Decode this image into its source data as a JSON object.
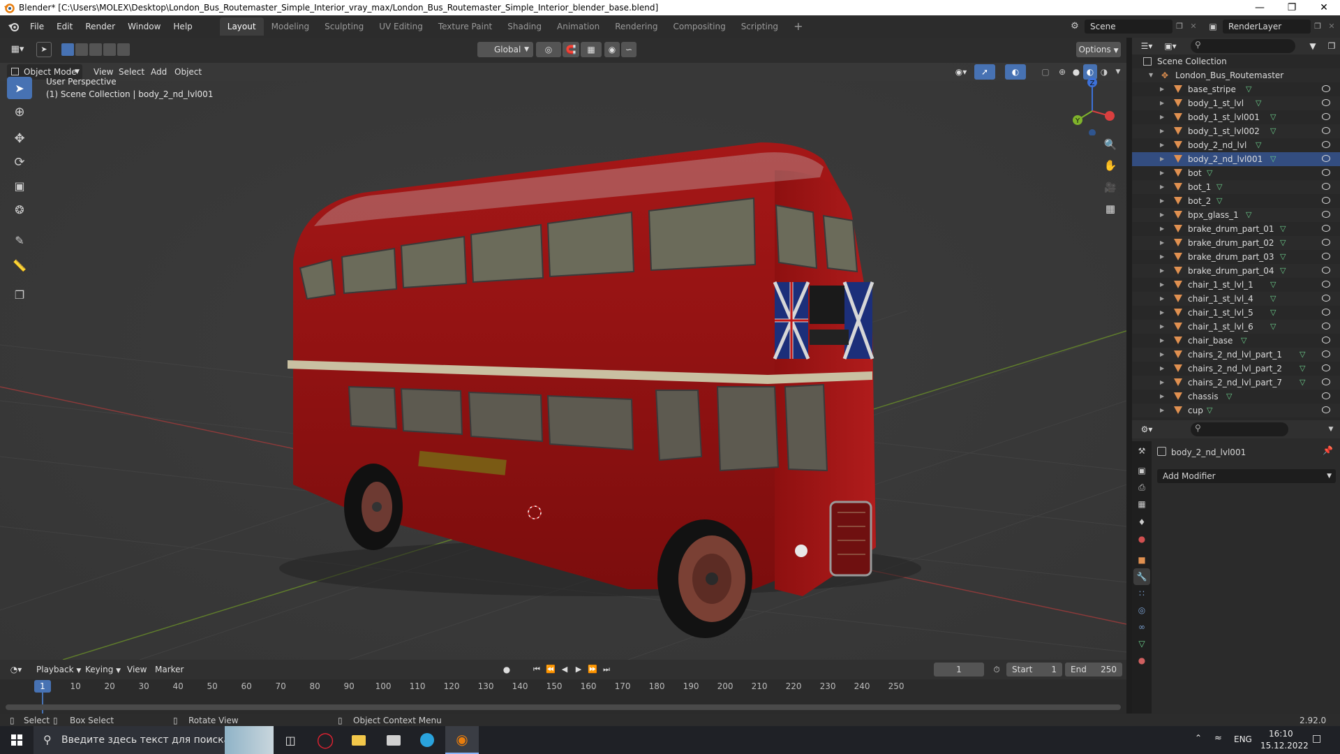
{
  "window": {
    "title": "Blender* [C:\\Users\\MOLEX\\Desktop\\London_Bus_Routemaster_Simple_Interior_vray_max/London_Bus_Routemaster_Simple_Interior_blender_base.blend]",
    "minimize_icon": "minimize-icon",
    "maximize_icon": "restore-icon",
    "close_icon": "close-icon"
  },
  "topbar": {
    "menus": [
      "File",
      "Edit",
      "Render",
      "Window",
      "Help"
    ],
    "workspaces": [
      "Layout",
      "Modeling",
      "Sculpting",
      "UV Editing",
      "Texture Paint",
      "Shading",
      "Animation",
      "Rendering",
      "Compositing",
      "Scripting"
    ],
    "active_workspace": "Layout",
    "add_workspace": "+",
    "scene_name": "Scene",
    "view_layer": "RenderLayer"
  },
  "viewport": {
    "mode": "Object Mode",
    "menus": [
      "View",
      "Select",
      "Add",
      "Object"
    ],
    "orientation": "Global",
    "options_label": "Options",
    "overlay_title": "User Perspective",
    "overlay_collection": "(1) Scene Collection | body_2_nd_lvl001",
    "gizmo_axes": [
      "Z",
      "Y",
      "X"
    ],
    "accent": "#4772b3",
    "object_color": "#8a1212"
  },
  "timeline": {
    "menus": [
      "Playback",
      "Keying",
      "View",
      "Marker"
    ],
    "current_frame": "1",
    "start_label": "Start",
    "start_value": "1",
    "end_label": "End",
    "end_value": "250",
    "frame_ticks": [
      "1",
      "10",
      "20",
      "30",
      "40",
      "50",
      "60",
      "70",
      "80",
      "90",
      "100",
      "110",
      "120",
      "130",
      "140",
      "150",
      "160",
      "170",
      "180",
      "190",
      "200",
      "210",
      "220",
      "230",
      "240",
      "250"
    ]
  },
  "statusbar": {
    "select": "Select",
    "box_select": "Box Select",
    "rotate_view": "Rotate View",
    "context_menu": "Object Context Menu",
    "version": "2.92.0"
  },
  "outliner": {
    "root": "Scene Collection",
    "collection": "London_Bus_Routemaster",
    "items": [
      "base_stripe",
      "body_1_st_lvl",
      "body_1_st_lvl001",
      "body_1_st_lvl002",
      "body_2_nd_lvl",
      "body_2_nd_lvl001",
      "bot",
      "bot_1",
      "bot_2",
      "bpx_glass_1",
      "brake_drum_part_01",
      "brake_drum_part_02",
      "brake_drum_part_03",
      "brake_drum_part_04",
      "chair_1_st_lvl_1",
      "chair_1_st_lvl_4",
      "chair_1_st_lvl_5",
      "chair_1_st_lvl_6",
      "chair_base",
      "chairs_2_nd_lvl_part_1",
      "chairs_2_nd_lvl_part_2",
      "chairs_2_nd_lvl_part_7",
      "chassis",
      "cup"
    ],
    "selected_item": "body_2_nd_lvl001"
  },
  "properties": {
    "object_name": "body_2_nd_lvl001",
    "add_modifier": "Add Modifier"
  },
  "taskbar": {
    "search_placeholder": "Введите здесь текст для поиска",
    "language": "ENG",
    "time": "16:10",
    "date": "15.12.2022"
  }
}
